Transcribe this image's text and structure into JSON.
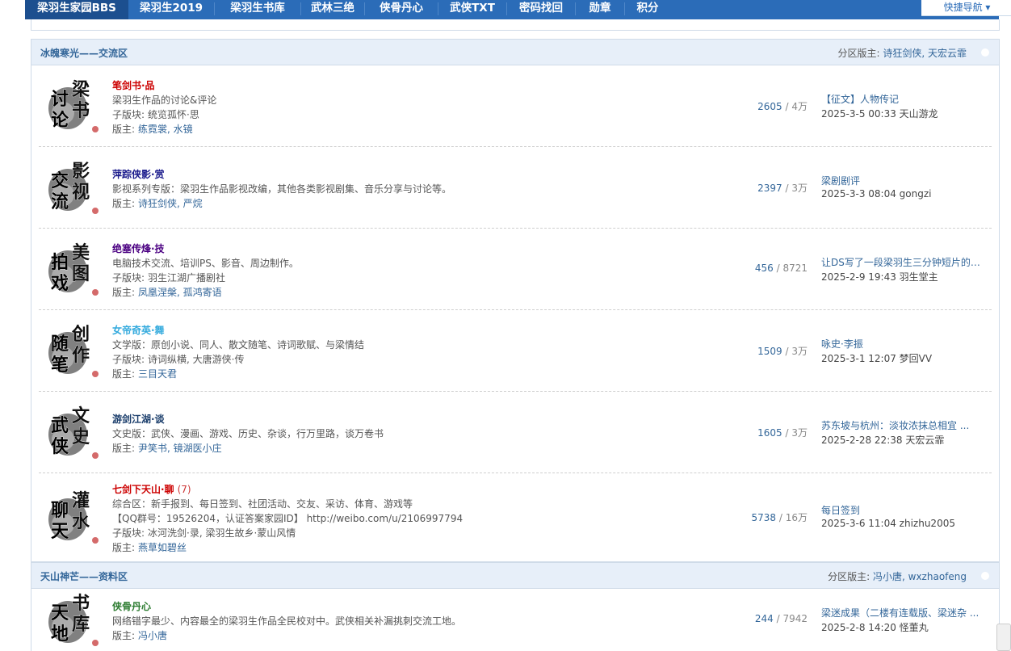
{
  "nav": {
    "items": [
      "梁羽生家园BBS",
      "梁羽生2019",
      "梁羽生书库",
      "武林三绝",
      "侠骨丹心",
      "武侠TXT",
      "密码找回",
      "勋章",
      "积分"
    ],
    "quick": "快捷导航 ▾"
  },
  "sections": [
    {
      "title": "冰魄寒光——交流区",
      "mod_label": "分区版主:",
      "mods": "诗狂剑侠, 天宏云霏",
      "forums": [
        {
          "name": "笔剑书·品",
          "name_color": "#cc0000",
          "logo": [
            "梁",
            "书",
            "讨",
            "论"
          ],
          "desc": "梁羽生作品的讨论&评论",
          "sub_label": "子版块:",
          "sub": "统览孤怀·思",
          "mod_label": "版主:",
          "mods": "练霓裳, 水镜",
          "threads": "2605",
          "posts": "4万",
          "last_title": "【征文】人物传记",
          "last_meta": "2025-3-5 00:33 天山游龙"
        },
        {
          "name": "萍踪侠影·赏",
          "name_color": "#1a1a8c",
          "logo": [
            "影",
            "视",
            "交",
            "流"
          ],
          "desc": "影视系列专版：梁羽生作品影视改编，其他各类影视剧集、音乐分享与讨论等。",
          "mod_label": "版主:",
          "mods": "诗狂剑侠, 严烷",
          "threads": "2397",
          "posts": "3万",
          "last_title": "梁剧剧评",
          "last_meta": "2025-3-3 08:04 gongzi"
        },
        {
          "name": "绝塞传烽·技",
          "name_color": "#4b0082",
          "logo": [
            "美",
            "图",
            "拍",
            "戏"
          ],
          "desc": "电脑技术交流、培训PS、影音、周边制作。",
          "sub_label": "子版块:",
          "sub": "羽生江湖广播剧社",
          "mod_label": "版主:",
          "mods": "凤凰涅槃, 孤鸿寄语",
          "threads": "456",
          "posts": "8721",
          "last_title": "让DS写了一段梁羽生三分钟短片的 ...",
          "last_meta": "2025-2-9 19:43 羽生堂主"
        },
        {
          "name": "女帝奇英·舞",
          "name_color": "#33aadd",
          "logo": [
            "创",
            "作",
            "随",
            "笔"
          ],
          "desc": "文学版：原创小说、同人、散文随笔、诗词歌赋、与梁情结",
          "sub_label": "子版块:",
          "sub": "诗词纵横, 大唐游侠·传",
          "mod_label": "版主:",
          "mods": "三目天君",
          "threads": "1509",
          "posts": "3万",
          "last_title": "咏史·李振",
          "last_meta": "2025-3-1 12:07 梦回VV"
        },
        {
          "name": "游剑江湖·谈",
          "name_color": "#1a3d6b",
          "logo": [
            "文",
            "史",
            "武",
            "侠"
          ],
          "desc": "文史版：武侠、漫画、游戏、历史、杂谈，行万里路，谈万卷书",
          "mod_label": "版主:",
          "mods": "尹笑书, 镜湖医小庄",
          "threads": "1605",
          "posts": "3万",
          "last_title": "苏东坡与杭州：淡妆浓抹总相宜 ...",
          "last_meta": "2025-2-28 22:38 天宏云霏"
        },
        {
          "name": "七剑下天山·聊",
          "name_color": "#cc0000",
          "badge": "(7)",
          "logo": [
            "灌",
            "水",
            "聊",
            "天"
          ],
          "desc": "综合区：新手报到、每日签到、社团活动、交友、采访、体育、游戏等",
          "desc2": "【QQ群号：19526204，认证答案家园ID】 http://weibo.com/u/2106997794",
          "sub_label": "子版块:",
          "sub": "冰河洗剑·录, 梁羽生故乡·蒙山风情",
          "mod_label": "版主:",
          "mods": "燕草如碧丝",
          "threads": "5738",
          "posts": "16万",
          "last_title": "每日签到",
          "last_meta": "2025-3-6 11:04 zhizhu2005"
        }
      ]
    },
    {
      "title": "天山神芒——资料区",
      "mod_label": "分区版主:",
      "mods": "冯小唐, wxzhaofeng",
      "forums": [
        {
          "name": "侠骨丹心",
          "name_color": "#2e7d32",
          "logo": [
            "书",
            "库",
            "天",
            "地"
          ],
          "desc": "网络错字最少、内容最全的梁羽生作品全民校对中。武侠相关补漏挑刺交流工地。",
          "mod_label": "版主:",
          "mods": "冯小唐",
          "threads": "244",
          "posts": "7942",
          "last_title": "梁迷成果（二楼有连载版、梁迷杂 ...",
          "last_meta": "2025-2-8 14:20 怪董丸"
        }
      ]
    }
  ]
}
